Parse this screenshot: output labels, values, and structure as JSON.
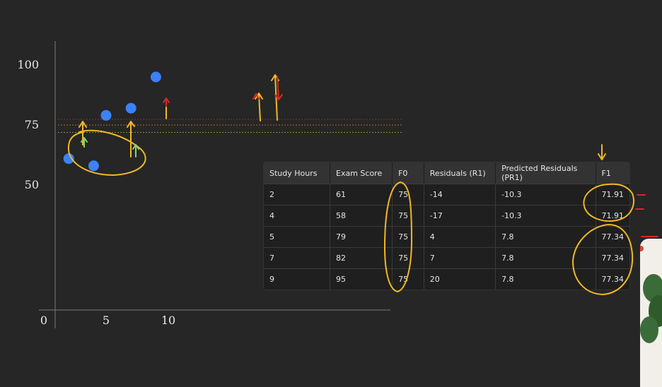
{
  "chart_data": {
    "type": "scatter",
    "x": [
      2,
      4,
      5,
      7,
      9
    ],
    "y": [
      61,
      58,
      79,
      82,
      95
    ],
    "xticks": [
      "0",
      "5",
      "10"
    ],
    "yticks": [
      "50",
      "75",
      "100"
    ],
    "xlim": [
      0,
      14
    ],
    "ylim": [
      0,
      105
    ],
    "hlines": [
      75,
      71.91,
      77.34
    ],
    "colors": {
      "point": "#3b82f6",
      "background": "#262626",
      "ink_yellow": "#f2b824",
      "ink_red": "#d6272b"
    }
  },
  "table": {
    "headers": [
      "Study Hours",
      "Exam Score",
      "F0",
      "Residuals (R1)",
      "Predicted Residuals (PR1)",
      "F1"
    ],
    "rows": [
      [
        "2",
        "61",
        "75",
        "-14",
        "-10.3",
        "71.91"
      ],
      [
        "4",
        "58",
        "75",
        "-17",
        "-10.3",
        "71.91"
      ],
      [
        "5",
        "79",
        "75",
        "4",
        "7.8",
        "77.34"
      ],
      [
        "7",
        "82",
        "75",
        "7",
        "7.8",
        "77.34"
      ],
      [
        "9",
        "95",
        "75",
        "20",
        "7.8",
        "77.34"
      ]
    ]
  }
}
